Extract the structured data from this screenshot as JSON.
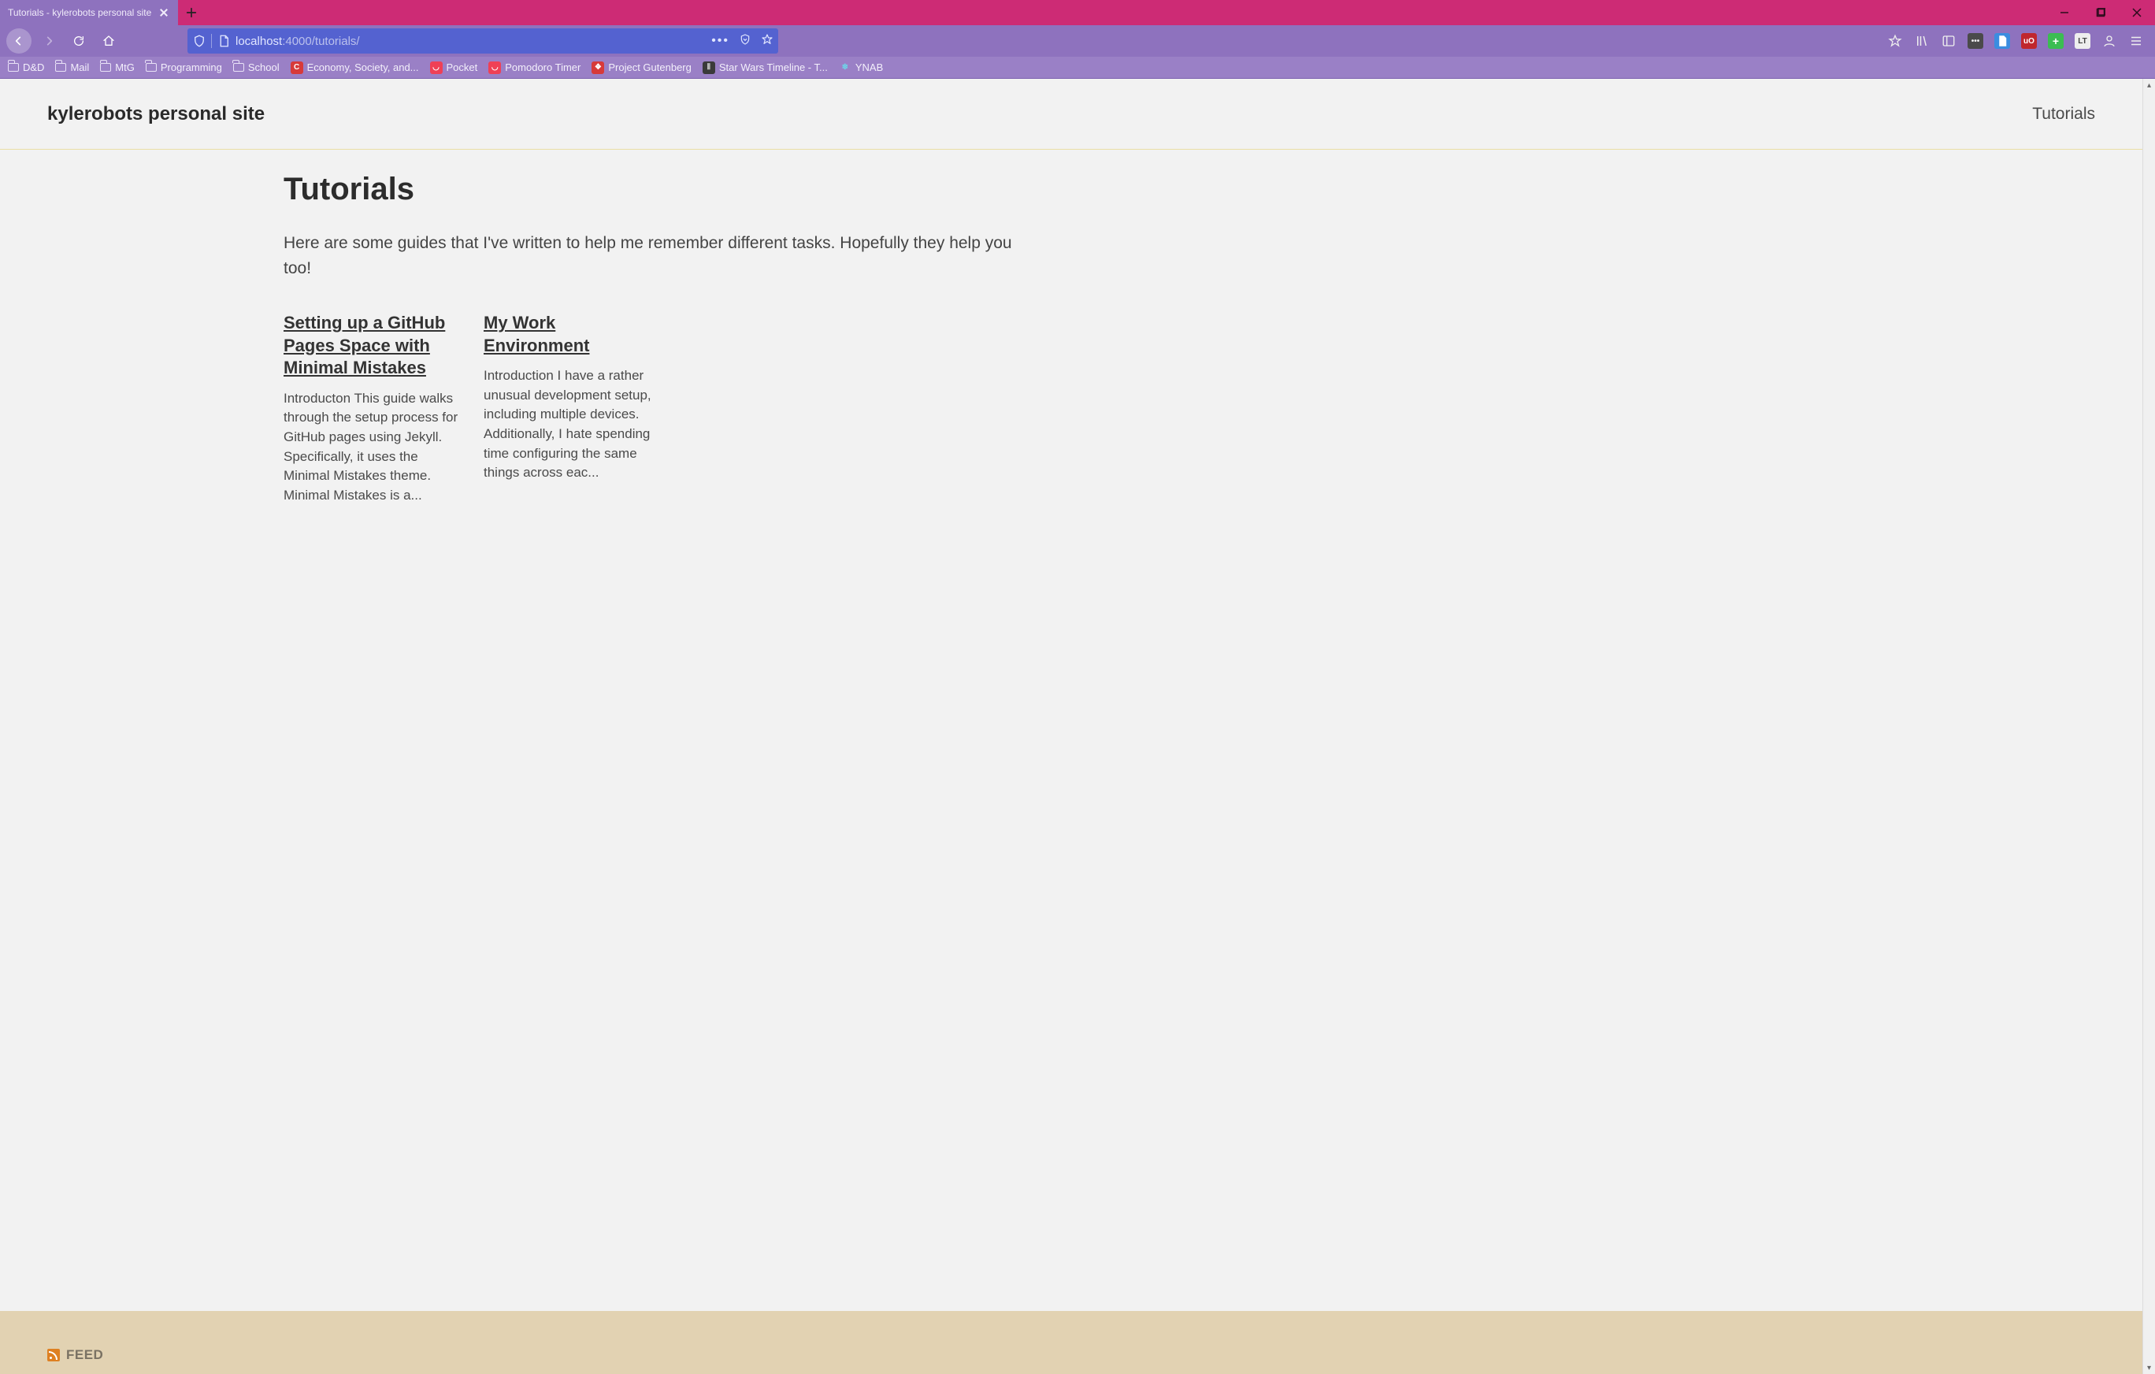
{
  "window": {
    "tab_title": "Tutorials - kylerobots personal site"
  },
  "url": {
    "host": "localhost",
    "port_path": ":4000/tutorials/"
  },
  "bookmarks": [
    {
      "label": "D&D",
      "type": "folder"
    },
    {
      "label": "Mail",
      "type": "folder"
    },
    {
      "label": "MtG",
      "type": "folder"
    },
    {
      "label": "Programming",
      "type": "folder"
    },
    {
      "label": "School",
      "type": "folder"
    },
    {
      "label": "Economy, Society, and...",
      "type": "site",
      "bg": "#d73a3a",
      "fg": "#fff",
      "glyph": "C"
    },
    {
      "label": "Pocket",
      "type": "site",
      "bg": "#ef4056",
      "fg": "#fff",
      "glyph": "◡"
    },
    {
      "label": "Pomodoro Timer",
      "type": "site",
      "bg": "#ef4056",
      "fg": "#fff",
      "glyph": "◡"
    },
    {
      "label": "Project Gutenberg",
      "type": "site",
      "bg": "#d73a3a",
      "fg": "#fff",
      "glyph": "❖"
    },
    {
      "label": "Star Wars Timeline - T...",
      "type": "site",
      "bg": "#3a3a3a",
      "fg": "#ccc",
      "glyph": "⦀"
    },
    {
      "label": "YNAB",
      "type": "site",
      "bg": "transparent",
      "fg": "#6fd3e8",
      "glyph": "❄"
    }
  ],
  "site": {
    "title": "kylerobots personal site",
    "nav_tutorials": "Tutorials",
    "page_heading": "Tutorials",
    "lead": "Here are some guides that I've written to help me remember different tasks. Hopefully they help you too!",
    "footer_feed": "FEED"
  },
  "posts": [
    {
      "title": "Setting up a GitHub Pages Space with Minimal Mistakes",
      "excerpt": "Introducton This guide walks through the setup process for GitHub pages using Jekyll. Specifically, it uses the Minimal Mistakes theme. Minimal Mistakes is a..."
    },
    {
      "title": "My Work Environment",
      "excerpt": "Introduction I have a rather unusual development setup, including multiple devices. Additionally, I hate spending time configuring the same things across eac..."
    }
  ]
}
